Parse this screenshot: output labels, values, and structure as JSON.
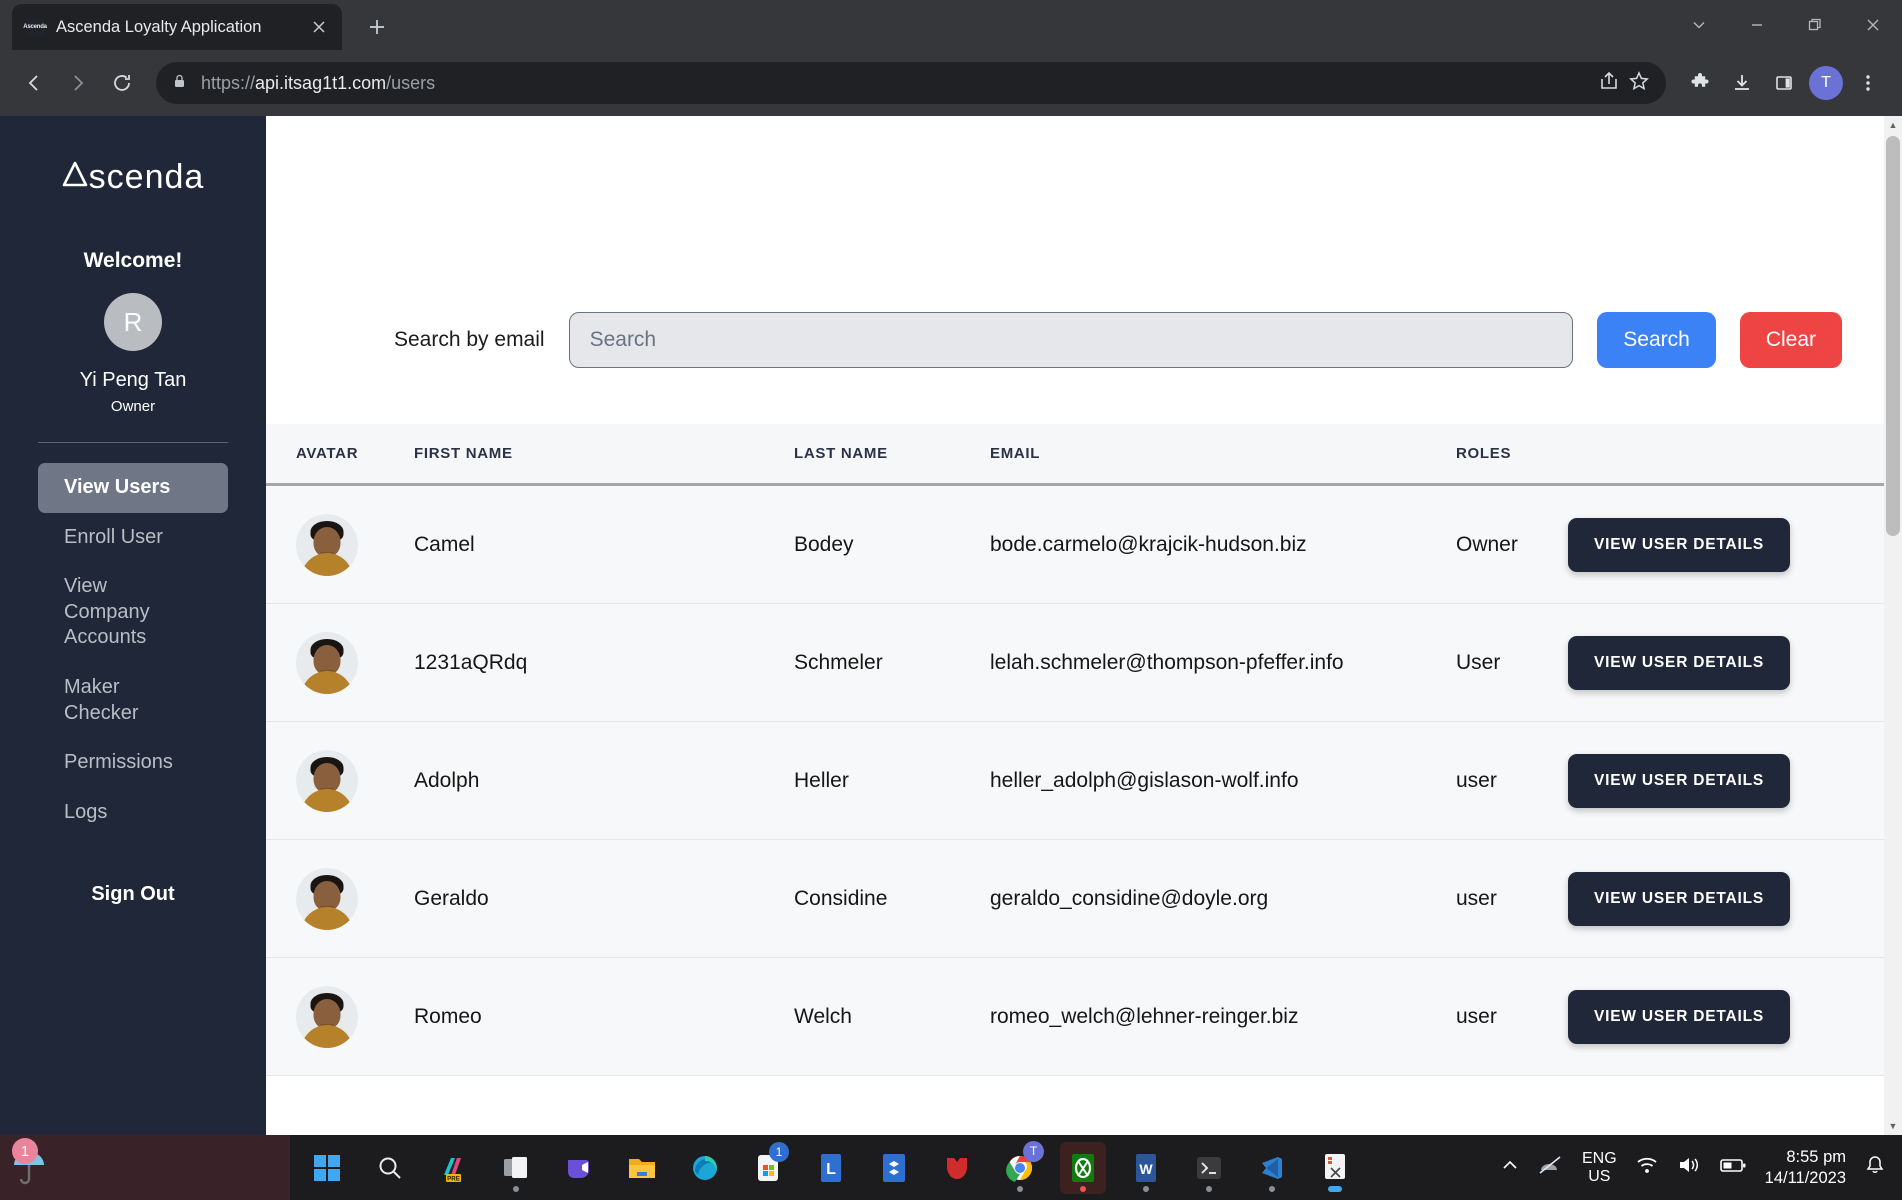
{
  "browser": {
    "tab": {
      "title": "Ascenda Loyalty Application",
      "favicon_label": "Ascenda",
      "close_icon": "close-icon"
    },
    "newtab_icon": "plus-icon",
    "window_controls": [
      "tab-search-chevron-icon",
      "minimize-icon",
      "restore-icon",
      "close-icon"
    ],
    "nav": {
      "back_icon": "back-arrow-icon",
      "forward_icon": "forward-arrow-icon",
      "reload_icon": "reload-icon"
    },
    "omnibox": {
      "lock_icon": "lock-icon",
      "scheme": "https://",
      "host": "api.itsag1t1.com",
      "path": "/users",
      "share_icon": "share-icon",
      "bookmark_icon": "star-icon"
    },
    "toolbar_right": {
      "extensions_icon": "puzzle-icon",
      "downloads_icon": "download-icon",
      "sidepanel_icon": "side-panel-icon",
      "profile_initial": "T",
      "menu_icon": "three-dot-menu-icon"
    }
  },
  "sidebar": {
    "logo": "Ascenda",
    "welcome": "Welcome!",
    "avatar_initial": "R",
    "user_name": "Yi Peng Tan",
    "user_role": "Owner",
    "nav_items": [
      {
        "label": "View Users",
        "active": true
      },
      {
        "label": "Enroll User",
        "active": false
      },
      {
        "label": "View Company Accounts",
        "active": false
      },
      {
        "label": "Maker Checker",
        "active": false
      },
      {
        "label": "Permissions",
        "active": false
      },
      {
        "label": "Logs",
        "active": false
      }
    ],
    "sign_out": "Sign Out"
  },
  "main": {
    "search": {
      "label": "Search by email",
      "value": "",
      "placeholder": "Search",
      "search_button": "Search",
      "clear_button": "Clear",
      "search_color": "#3b82f6",
      "clear_color": "#ef4444"
    },
    "table": {
      "columns": [
        "AVATAR",
        "FIRST NAME",
        "LAST NAME",
        "EMAIL",
        "ROLES"
      ],
      "action_label": "VIEW USER DETAILS",
      "rows": [
        {
          "first_name": "Camel",
          "last_name": "Bodey",
          "email": "bode.carmelo@krajcik-hudson.biz",
          "role": "Owner"
        },
        {
          "first_name": "1231aQRdq",
          "last_name": "Schmeler",
          "email": "lelah.schmeler@thompson-pfeffer.info",
          "role": "User"
        },
        {
          "first_name": "Adolph",
          "last_name": "Heller",
          "email": "heller_adolph@gislason-wolf.info",
          "role": "user"
        },
        {
          "first_name": "Geraldo",
          "last_name": "Considine",
          "email": "geraldo_considine@doyle.org",
          "role": "user"
        },
        {
          "first_name": "Romeo",
          "last_name": "Welch",
          "email": "romeo_welch@lehner-reinger.biz",
          "role": "user"
        }
      ]
    }
  },
  "taskbar": {
    "corner_badge": "1",
    "corner_icon": "umbrella-icon",
    "icons": [
      "windows-start-icon",
      "search-icon",
      "copilot-pre-icon",
      "task-view-icon",
      "teams-icon",
      "file-explorer-icon",
      "edge-icon",
      "microsoft-store-icon",
      "linear-icon",
      "dropbox-icon",
      "brave-icon",
      "chrome-icon",
      "xbox-icon",
      "word-icon",
      "terminal-icon",
      "vscode-icon",
      "snipping-tool-icon"
    ],
    "store_badge": "1",
    "chrome_badge": "T",
    "tray": {
      "overflow_icon": "chevron-up-icon",
      "meet_now_icon": "meet-now-off-icon",
      "language": "ENG",
      "region": "US",
      "wifi_icon": "wifi-icon",
      "volume_icon": "speaker-icon",
      "battery_icon": "battery-icon",
      "time": "8:55 pm",
      "date": "14/11/2023",
      "notification_icon": "bell-icon"
    }
  }
}
